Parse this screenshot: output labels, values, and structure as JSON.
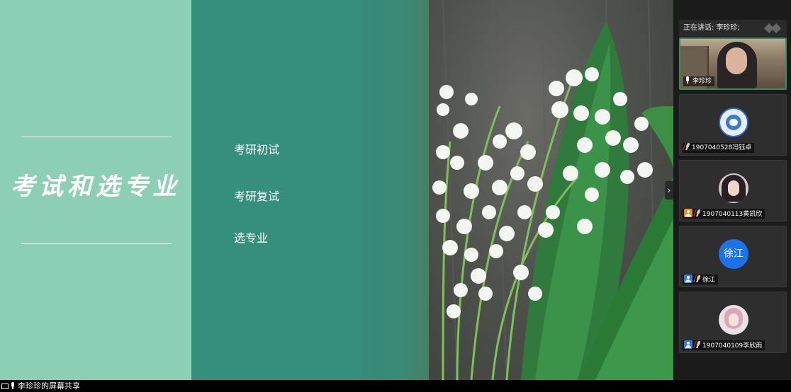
{
  "slide": {
    "title": "考试和选专业",
    "menu": [
      "考研初试",
      "考研复试",
      "选专业"
    ]
  },
  "sidebar": {
    "speaking_label": "正在讲话: 李珍珍;",
    "participants": [
      {
        "name": "李珍珍",
        "type": "video",
        "mic": "on"
      },
      {
        "name": "1907040528冯钰卓",
        "type": "avatar-robot",
        "mic": "muted"
      },
      {
        "name": "1907040113黄凯欣",
        "type": "avatar-girl",
        "mic": "muted",
        "role": "orange"
      },
      {
        "name": "徐江",
        "type": "avatar-text",
        "avatar_text": "徐江",
        "mic": "muted",
        "role": "blue"
      },
      {
        "name": "1907040109李欣雨",
        "type": "avatar-pink",
        "mic": "muted",
        "role": "blue"
      }
    ],
    "collapse_icon": "chevron-right-icon"
  },
  "statusbar": {
    "label": "李珍珍的屏幕共享"
  },
  "colors": {
    "panel_left": "#8ccfb4",
    "panel_mid": "#368f7d",
    "active_border": "#3c8a64",
    "avatar_blue": "#1a73e8"
  }
}
